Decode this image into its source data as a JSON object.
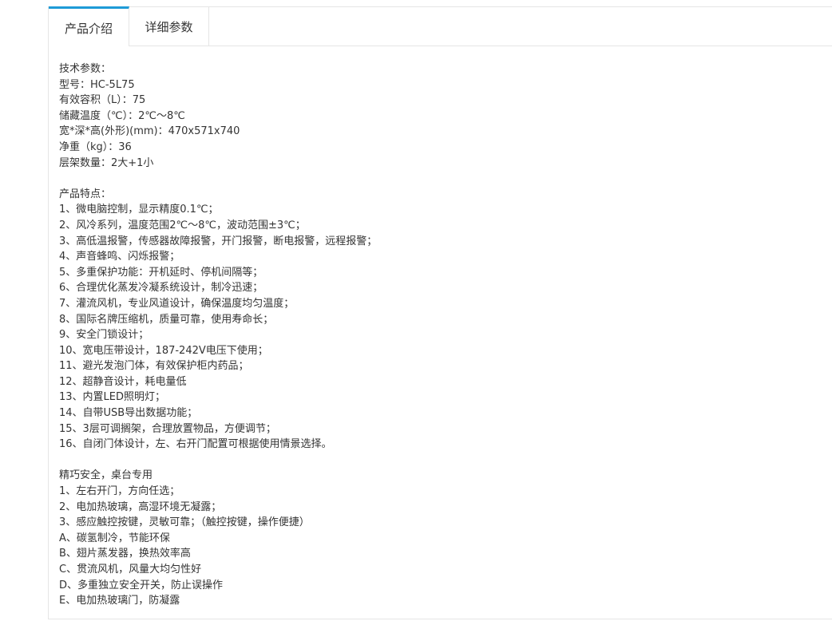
{
  "tabs": {
    "intro": "产品介绍",
    "params": "详细参数"
  },
  "specs": {
    "heading": "技术参数：",
    "lines": [
      "型号：HC-5L75",
      "有效容积（L）：75",
      "储藏温度（℃）：2℃～8℃",
      "宽*深*高(外形)(mm)：470x571x740",
      "净重（kg）：36",
      "层架数量：2大+1小"
    ]
  },
  "features": {
    "heading": "产品特点：",
    "lines": [
      "1、微电脑控制，显示精度0.1℃；",
      "2、风冷系列，温度范围2℃～8℃，波动范围±3℃；",
      "3、高低温报警，传感器故障报警，开门报警，断电报警，远程报警；",
      "4、声音蜂鸣、闪烁报警；",
      "5、多重保护功能：开机延时、停机间隔等；",
      "6、合理优化蒸发冷凝系统设计，制冷迅速；",
      "7、灌流风机，专业风道设计，确保温度均匀温度；",
      "8、国际名牌压缩机，质量可靠，使用寿命长；",
      "9、安全门锁设计；",
      "10、宽电压带设计，187-242V电压下使用；",
      "11、避光发泡门体，有效保护柜内药品；",
      "12、超静音设计，耗电量低",
      "13、内置LED照明灯；",
      "14、自带USB导出数据功能；",
      "15、3层可调搁架，合理放置物品，方便调节；",
      "16、自闭门体设计，左、右开门配置可根据使用情景选择。"
    ]
  },
  "safety": {
    "heading": "精巧安全，桌台专用",
    "lines": [
      "1、左右开门，方向任选；",
      "2、电加热玻璃，高湿环境无凝露；",
      "3、感应触控按键，灵敏可靠；（触控按键，操作便捷）",
      "A、碳氢制冷，节能环保",
      "B、翅片蒸发器，换热效率高",
      "C、贯流风机，风量大均匀性好",
      "D、多重独立安全开关，防止误操作",
      "E、电加热玻璃门，防凝露"
    ]
  }
}
